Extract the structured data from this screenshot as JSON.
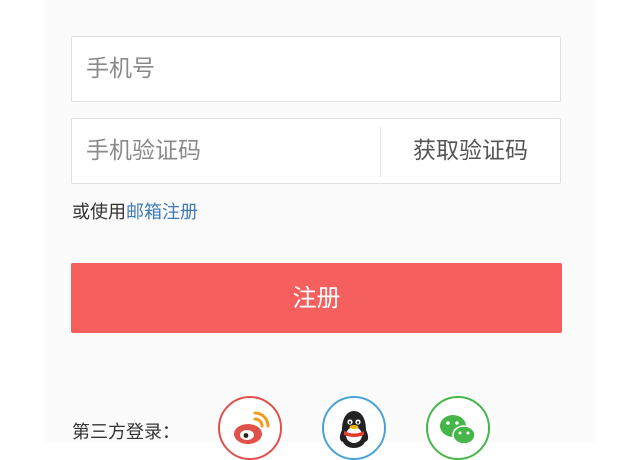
{
  "form": {
    "phone_placeholder": "手机号",
    "code_placeholder": "手机验证码",
    "get_code_label": "获取验证码",
    "alt_prefix": "或使用",
    "alt_link": "邮箱注册",
    "submit_label": "注册"
  },
  "social": {
    "label": "第三方登录：",
    "providers": [
      {
        "icon": "weibo-icon",
        "color": "#e0514c"
      },
      {
        "icon": "qq-icon",
        "color": "#4aa3d8"
      },
      {
        "icon": "wechat-icon",
        "color": "#46b64a"
      }
    ]
  }
}
